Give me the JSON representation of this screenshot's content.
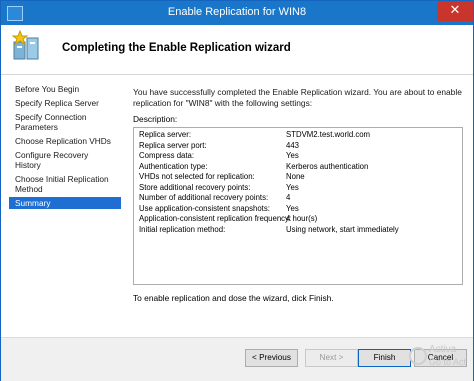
{
  "window": {
    "title": "Enable Replication for WIN8",
    "close_glyph": "✕"
  },
  "header": {
    "heading": "Completing the Enable Replication wizard",
    "icon": "replication-wizard-icon"
  },
  "nav": {
    "items": [
      {
        "label": "Before You Begin",
        "selected": false
      },
      {
        "label": "Specify Replica Server",
        "selected": false
      },
      {
        "label": "Specify Connection Parameters",
        "selected": false
      },
      {
        "label": "Choose Replication VHDs",
        "selected": false
      },
      {
        "label": "Configure Recovery History",
        "selected": false
      },
      {
        "label": "Choose Initial Replication Method",
        "selected": false
      },
      {
        "label": "Summary",
        "selected": true
      }
    ]
  },
  "main": {
    "intro": "You have successfully completed the Enable Replication wizard. You are about to enable replication for \"WIN8\" with the following settings:",
    "description_label": "Description:",
    "settings": [
      {
        "label": "Replica server:",
        "value": "STDVM2.test.world.com"
      },
      {
        "label": "Replica server port:",
        "value": "443"
      },
      {
        "label": "Compress data:",
        "value": "Yes"
      },
      {
        "label": "Authentication type:",
        "value": "Kerberos authentication"
      },
      {
        "label": "VHDs not selected for replication:",
        "value": "None"
      },
      {
        "label": "Store additional recovery points:",
        "value": "Yes"
      },
      {
        "label": "Number of additional recovery points:",
        "value": "4"
      },
      {
        "label": "Use application-consistent snapshots:",
        "value": "Yes"
      },
      {
        "label": "Application-consistent replication frequency:",
        "value": "4 hour(s)"
      },
      {
        "label": "Initial replication method:",
        "value": "Using network, start immediately"
      }
    ],
    "finish_note": "To enable replication and dose the wizard, dick Finish."
  },
  "footer": {
    "previous_label": "< Previous",
    "next_label": "Next >",
    "finish_label": "Finish",
    "cancel_label": "Cancel"
  },
  "watermark": {
    "line1": "Activa",
    "line2": "Go to Act"
  },
  "colors": {
    "titlebar": "#1976c9",
    "close": "#c9342b",
    "selected_nav": "#1e6fd1"
  }
}
